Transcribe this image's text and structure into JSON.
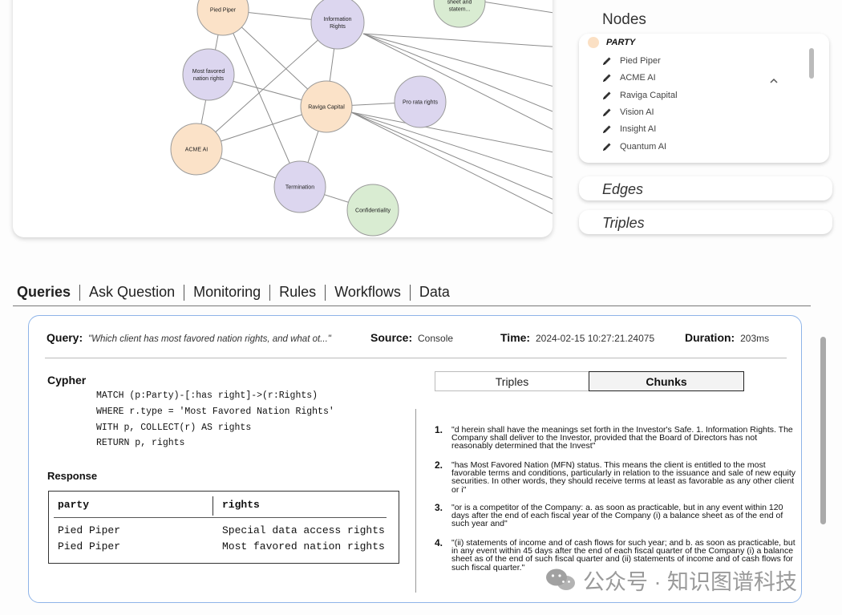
{
  "graph": {
    "nodes": [
      {
        "id": "pied-piper",
        "label": "Pied Piper",
        "type": "party"
      },
      {
        "id": "information-rights",
        "label": "Information Rights",
        "type": "rights"
      },
      {
        "id": "deliver",
        "label": "Deliver balance sheet and statem...",
        "type": "other"
      },
      {
        "id": "most-favored",
        "label": "Most favored nation rights",
        "type": "rights"
      },
      {
        "id": "raviga-capital",
        "label": "Raviga Capital",
        "type": "party"
      },
      {
        "id": "pro-rata",
        "label": "Pro rata rights",
        "type": "rights"
      },
      {
        "id": "acme-ai",
        "label": "ACME AI",
        "type": "party"
      },
      {
        "id": "termination",
        "label": "Termination",
        "type": "rights"
      },
      {
        "id": "confidentiality",
        "label": "Confidentiality",
        "type": "other"
      }
    ],
    "colors": {
      "party": "#fbe2c8",
      "rights": "#dcd6ef",
      "other": "#d9ecd2",
      "edge": "#8c8c8c",
      "stroke": "#9a9a9a"
    }
  },
  "panel": {
    "nodes_title": "Nodes",
    "party_label": "PARTY",
    "items": [
      "Pied Piper",
      "ACME AI",
      "Raviga Capital",
      "Vision AI",
      "Insight AI",
      "Quantum AI"
    ],
    "edges_label": "Edges",
    "triples_label": "Triples"
  },
  "tabs": [
    "Queries",
    "Ask Question",
    "Monitoring",
    "Rules",
    "Workflows",
    "Data"
  ],
  "query": {
    "query_key": "Query:",
    "query_val": "\"Which client has most favored nation rights, and what ot...\"",
    "source_key": "Source:",
    "source_val": "Console",
    "time_key": "Time:",
    "time_val": "2024-02-15 10:27:21.24075",
    "duration_key": "Duration:",
    "duration_val": "203ms",
    "cypher_title": "Cypher",
    "cypher_code": "MATCH (p:Party)-[:has right]->(r:Rights)\nWHERE r.type = 'Most Favored Nation Rights'\nWITH p, COLLECT(r) AS rights\nRETURN p, rights",
    "response_title": "Response",
    "table": {
      "headers": [
        "party",
        "rights"
      ],
      "rows": [
        [
          "Pied Piper",
          "Special data access rights"
        ],
        [
          "Pied Piper",
          "Most favored nation rights"
        ]
      ]
    },
    "toggle": {
      "triples": "Triples",
      "chunks": "Chunks",
      "active": "chunks"
    },
    "chunks": [
      {
        "num": "1.",
        "text": "\"d herein shall have the meanings set forth in the Investor's Safe. 1. Information Rights. The Company shall deliver to the Investor, provided that the Board of Directors has not reasonably determined that the Invest\""
      },
      {
        "num": "2.",
        "text": "\"has Most Favored Nation (MFN) status. This means the client is entitled to the most favorable terms and conditions, particularly in relation to the issuance and sale of new equity securities. In other words, they should receive terms at least as favorable as any other client or i\""
      },
      {
        "num": "3.",
        "text": "\"or is a competitor of the Company: a. as soon as practicable, but in any event within 120 days after the end of each fiscal year of the Company (i) a balance sheet as of the end of such year and\""
      },
      {
        "num": "4.",
        "text": "\"(ii) statements of income and of cash flows for such year; and b. as soon as practicable, but in any event within 45 days after the end of each fiscal quarter of the Company (i) a balance sheet as of the end of such fiscal quarter and (ii) statements of income and of cash flows for such fiscal quarter.\""
      }
    ]
  },
  "watermark": "公众号 · 知识图谱科技"
}
